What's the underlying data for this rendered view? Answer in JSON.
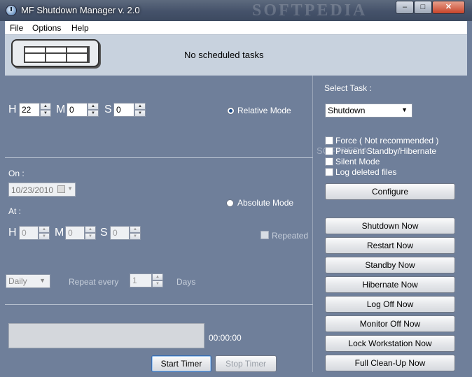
{
  "window": {
    "title": "MF Shutdown Manager v. 2.0",
    "watermark": "SOFTPEDIA",
    "controls": {
      "minimize": "–",
      "maximize": "□",
      "close": "✕"
    }
  },
  "menu": {
    "items": [
      "File",
      "Options",
      "Help"
    ]
  },
  "banner": {
    "status": "No scheduled tasks"
  },
  "relative": {
    "h_label": "H",
    "m_label": "M",
    "s_label": "S",
    "hours": "22",
    "minutes": "0",
    "seconds": "0",
    "mode_label": "Relative Mode",
    "selected": true
  },
  "absolute": {
    "on_label": "On :",
    "date": "10/23/2010",
    "at_label": "At :",
    "h_label": "H",
    "m_label": "M",
    "s_label": "S",
    "hours": "0",
    "minutes": "0",
    "seconds": "0",
    "mode_label": "Absolute Mode",
    "repeated_label": "Repeated",
    "selected": false
  },
  "repeat": {
    "frequency": "Daily",
    "every_label": "Repeat every",
    "count": "1",
    "unit_label": "Days"
  },
  "timer": {
    "elapsed": "00:00:00",
    "start_label": "Start Timer",
    "stop_label": "Stop Timer",
    "progress": 0
  },
  "task": {
    "select_label": "Select Task :",
    "selected": "Shutdown",
    "watermark": "SOFTPEDIA",
    "options": [
      {
        "label": "Force ( Not recommended )",
        "checked": false
      },
      {
        "label": "Prevent Standby/Hibernate",
        "checked": false
      },
      {
        "label": "Silent Mode",
        "checked": false
      },
      {
        "label": "Log deleted files",
        "checked": false
      }
    ],
    "configure_label": "Configure"
  },
  "actions": [
    "Shutdown Now",
    "Restart Now",
    "Standby Now",
    "Hibernate Now",
    "Log Off Now",
    "Monitor Off Now",
    "Lock Workstation Now",
    "Full Clean-Up Now"
  ]
}
